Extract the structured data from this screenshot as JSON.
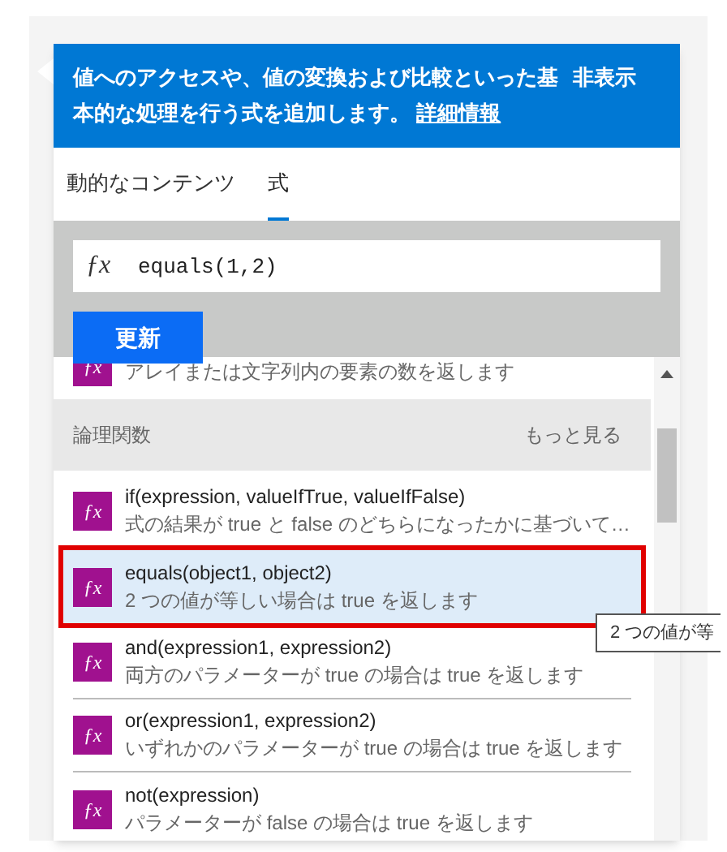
{
  "info_banner": {
    "text": "値へのアクセスや、値の変換および比較といった基本的な処理を行う式を追加します。",
    "link": "詳細情報",
    "hide_button": "非表示"
  },
  "tabs": [
    {
      "label": "動的なコンテンツ",
      "selected": false
    },
    {
      "label": "式",
      "selected": true
    }
  ],
  "expression_field": {
    "icon": "ƒx",
    "value": "equals(1,2)"
  },
  "update_button": "更新",
  "function_list": {
    "partial_row": {
      "icon": "ƒx",
      "description": "アレイまたは文字列内の要素の数を返します"
    },
    "category": {
      "title": "論理関数",
      "more_link": "もっと見る"
    },
    "items": [
      {
        "icon": "ƒx",
        "signature": "if(expression, valueIfTrue, valueIfFalse)",
        "description": "式の結果が true と false のどちらになったかに基づいて…",
        "selected": false
      },
      {
        "icon": "ƒx",
        "signature": "equals(object1, object2)",
        "description": "2 つの値が等しい場合は true を返します",
        "selected": true
      },
      {
        "icon": "ƒx",
        "signature": "and(expression1, expression2)",
        "description": "両方のパラメーターが true の場合は true を返します",
        "selected": false
      },
      {
        "icon": "ƒx",
        "signature": "or(expression1, expression2)",
        "description": "いずれかのパラメーターが true の場合は true を返します",
        "selected": false
      },
      {
        "icon": "ƒx",
        "signature": "not(expression)",
        "description": "パラメーターが false の場合は true を返します",
        "selected": false
      }
    ]
  },
  "tooltip": "2 つの値が等"
}
